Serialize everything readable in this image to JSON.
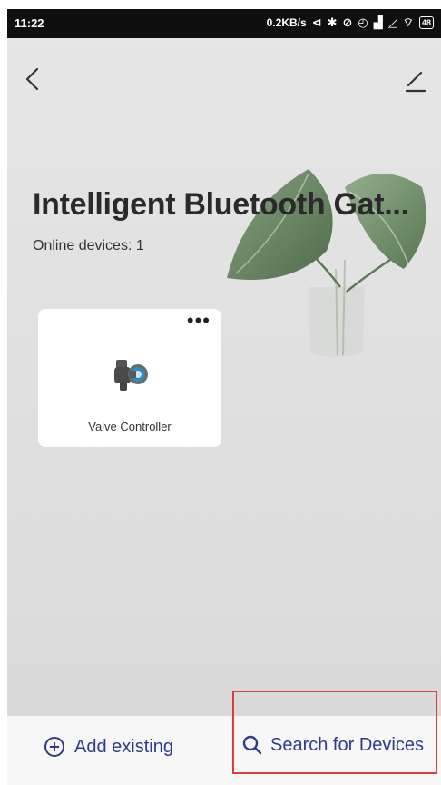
{
  "status_bar": {
    "time": "11:22",
    "network_speed": "0.2KB/s",
    "battery": "48"
  },
  "header": {
    "title": "Intelligent Bluetooth Gat...",
    "subtitle": "Online devices: 1"
  },
  "devices": [
    {
      "label": "Valve Controller",
      "more": "•••"
    }
  ],
  "bottom_bar": {
    "add_existing_label": "Add existing",
    "search_label": "Search for Devices"
  },
  "colors": {
    "accent": "#2e3a8f",
    "highlight_box": "#e03a3a",
    "background": "#e1e1e1"
  }
}
